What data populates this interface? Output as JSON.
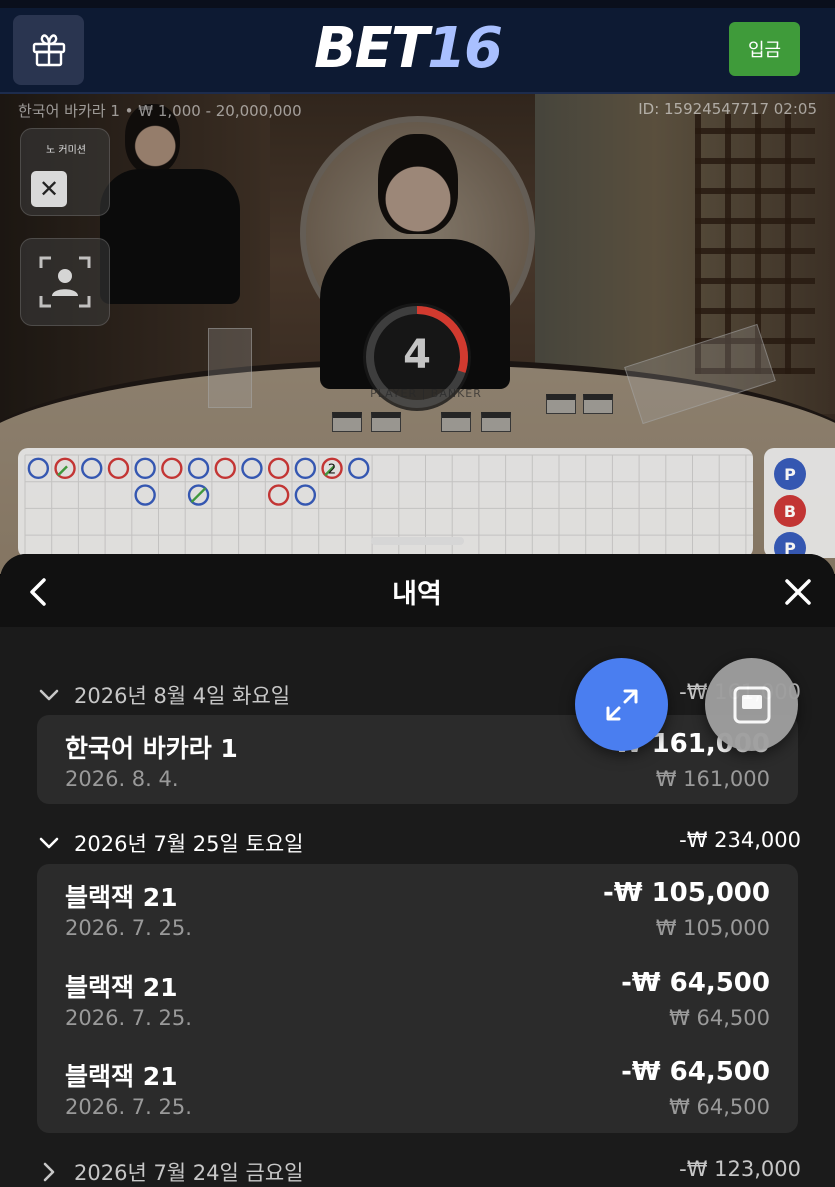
{
  "header": {
    "logo_main": "BET",
    "logo_num": "16",
    "deposit_label": "입금"
  },
  "video": {
    "table_info": "한국어 바카라 1 • ₩ 1,000 - 20,000,000",
    "id_info": "ID: 15924547717 02:05",
    "no_commission_label": "노 커미션",
    "countdown": "4",
    "player_banker_label": "PLAYER | BANKER",
    "countdown_fraction": 0.3
  },
  "roadmap": {
    "row1": [
      "P",
      "B",
      "P",
      "B",
      "P",
      "B",
      "P",
      "B",
      "P",
      "B",
      "P",
      "B",
      "P"
    ],
    "row1_tie_marks": [
      1,
      11
    ],
    "row1_tie_count": "2",
    "row2": [
      {
        "col": 4,
        "type": "P"
      },
      {
        "col": 6,
        "type": "T"
      },
      {
        "col": 9,
        "type": "B"
      },
      {
        "col": 10,
        "type": "P"
      }
    ],
    "stats": [
      "P",
      "B",
      "P"
    ]
  },
  "sheet": {
    "title": "내역",
    "groups": [
      {
        "date": "2026년 8월 4일 화요일",
        "total": "-₩ 161,000",
        "expanded": true,
        "entries": [
          {
            "name": "한국어 바카라 1",
            "date": "2026. 8. 4.",
            "amount": "₩ 161,000",
            "sub": "₩ 161,000"
          }
        ]
      },
      {
        "date": "2026년 7월 25일 토요일",
        "total": "-₩ 234,000",
        "expanded": true,
        "entries": [
          {
            "name": "블랙잭 21",
            "date": "2026. 7. 25.",
            "amount": "-₩ 105,000",
            "sub": "₩ 105,000"
          },
          {
            "name": "블랙잭 21",
            "date": "2026. 7. 25.",
            "amount": "-₩ 64,500",
            "sub": "₩ 64,500"
          },
          {
            "name": "블랙잭 21",
            "date": "2026. 7. 25.",
            "amount": "-₩ 64,500",
            "sub": "₩ 64,500"
          }
        ]
      },
      {
        "date": "2026년 7월 24일 금요일",
        "total": "-₩ 123,000",
        "expanded": false,
        "entries": []
      }
    ]
  },
  "colors": {
    "header_bg": "#0d1a33",
    "deposit_green": "#3f9b3a",
    "expand_blue": "#4a7ef0",
    "player_blue": "#2f55b8",
    "banker_red": "#c83030",
    "tie_green": "#3a9b3a"
  },
  "icons": [
    "gift-icon",
    "close-icon",
    "person-frame-icon",
    "chevron-left-icon",
    "chevron-down-icon",
    "chevron-right-icon",
    "expand-icon",
    "pip-icon"
  ]
}
